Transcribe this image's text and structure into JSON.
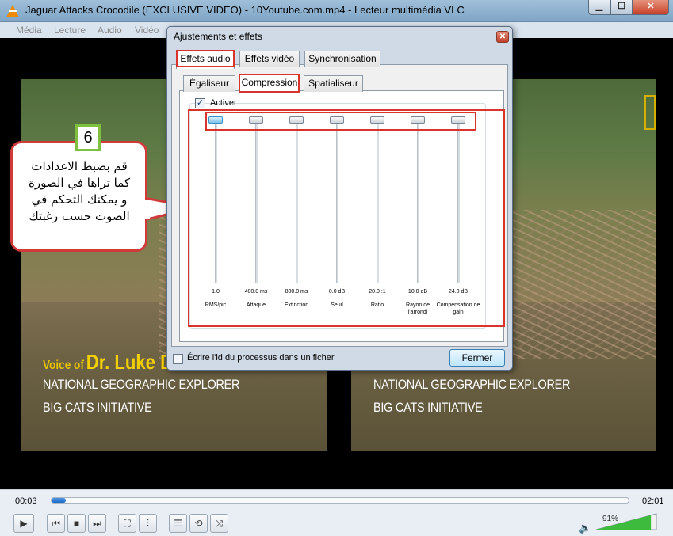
{
  "window": {
    "title": "Jaguar Attacks Crocodile (EXCLUSIVE VIDEO) - 10Youtube.com.mp4 - Lecteur multimédia VLC",
    "menu": [
      "Média",
      "Lecture",
      "Audio",
      "Vidéo"
    ]
  },
  "video": {
    "voice_prefix": "Voice of",
    "voice_name_left": "Dr. Luke Dolla",
    "line1": "NATIONAL GEOGRAPHIC EXPLORER",
    "line2": "BIG CATS INITIATIVE"
  },
  "callout": {
    "number": "6",
    "lines": [
      "قم بضبط الاعدادات",
      "كما تراها في الصورة",
      "و يمكنك التحكم في",
      "الصوت حسب رغبتك"
    ]
  },
  "dialog": {
    "title": "Ajustements et effets",
    "close_glyph": "✕",
    "tabs": [
      "Effets audio",
      "Effets vidéo",
      "Synchronisation"
    ],
    "subtabs": [
      "Égaliseur",
      "Compression",
      "Spatialiseur"
    ],
    "activer_label": "Activer",
    "activer_checked": true,
    "sliders": [
      {
        "value": "1.0",
        "label": "RMS/pic"
      },
      {
        "value": "400.0 ms",
        "label": "Attaque"
      },
      {
        "value": "800.0 ms",
        "label": "Extinction"
      },
      {
        "value": "0.0 dB",
        "label": "Seuil"
      },
      {
        "value": "20.0 :1",
        "label": "Ratio"
      },
      {
        "value": "10.0 dB",
        "label": "Rayon de l'arrondi"
      },
      {
        "value": "24.0 dB",
        "label": "Compensation de gain"
      }
    ],
    "ecrire_label": "Écrire l'id du processus dans un ficher",
    "fermer_label": "Fermer"
  },
  "controls": {
    "time_current": "00:03",
    "time_total": "02:01",
    "progress": 0.025,
    "volume_percent": "91%",
    "volume": 0.91
  }
}
